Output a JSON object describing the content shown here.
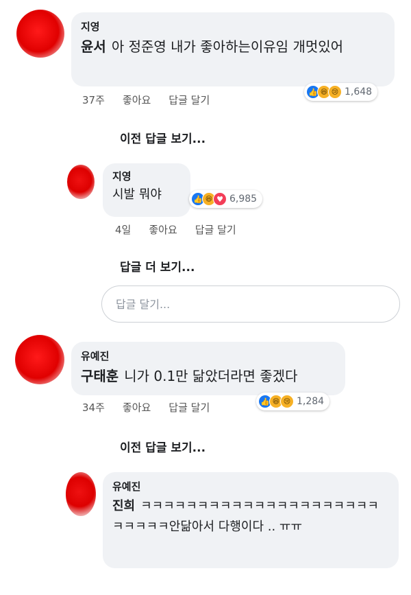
{
  "comments": [
    {
      "author": "지영",
      "tag": "윤서",
      "text": "아 정준영 내가 좋아하는이유임 개멋있어",
      "time": "37주",
      "like_label": "좋아요",
      "reply_label": "답글 달기",
      "reactions": [
        "like",
        "haha",
        "sad"
      ],
      "reaction_count": "1,648",
      "view_prev": "이전 답글 보기..."
    },
    {
      "author": "유예진",
      "tag": "구태훈",
      "text": "니가 0.1만 닮았더라면 좋겠다",
      "time": "34주",
      "like_label": "좋아요",
      "reply_label": "답글 달기",
      "reactions": [
        "like",
        "haha",
        "sad"
      ],
      "reaction_count": "1,284",
      "view_prev": "이전 답글 보기..."
    }
  ],
  "replies": [
    {
      "author": "지영",
      "text": "시발 뭐야",
      "time": "4일",
      "like_label": "좋아요",
      "reply_label": "답글 달기",
      "reactions": [
        "like",
        "haha",
        "love"
      ],
      "reaction_count": "6,985",
      "more": "답글 더 보기..."
    },
    {
      "author": "유예진",
      "tag": "진희",
      "text": "ㅋㅋㅋㅋㅋㅋㅋㅋㅋㅋㅋㅋㅋㅋㅋㅋㅋㅋㅋㅋㅋㅋㅋㅋㅋㅋ안닮아서 다행이다 .. ㅠㅠ"
    }
  ],
  "reply_input": {
    "placeholder": "답글 달기..."
  }
}
